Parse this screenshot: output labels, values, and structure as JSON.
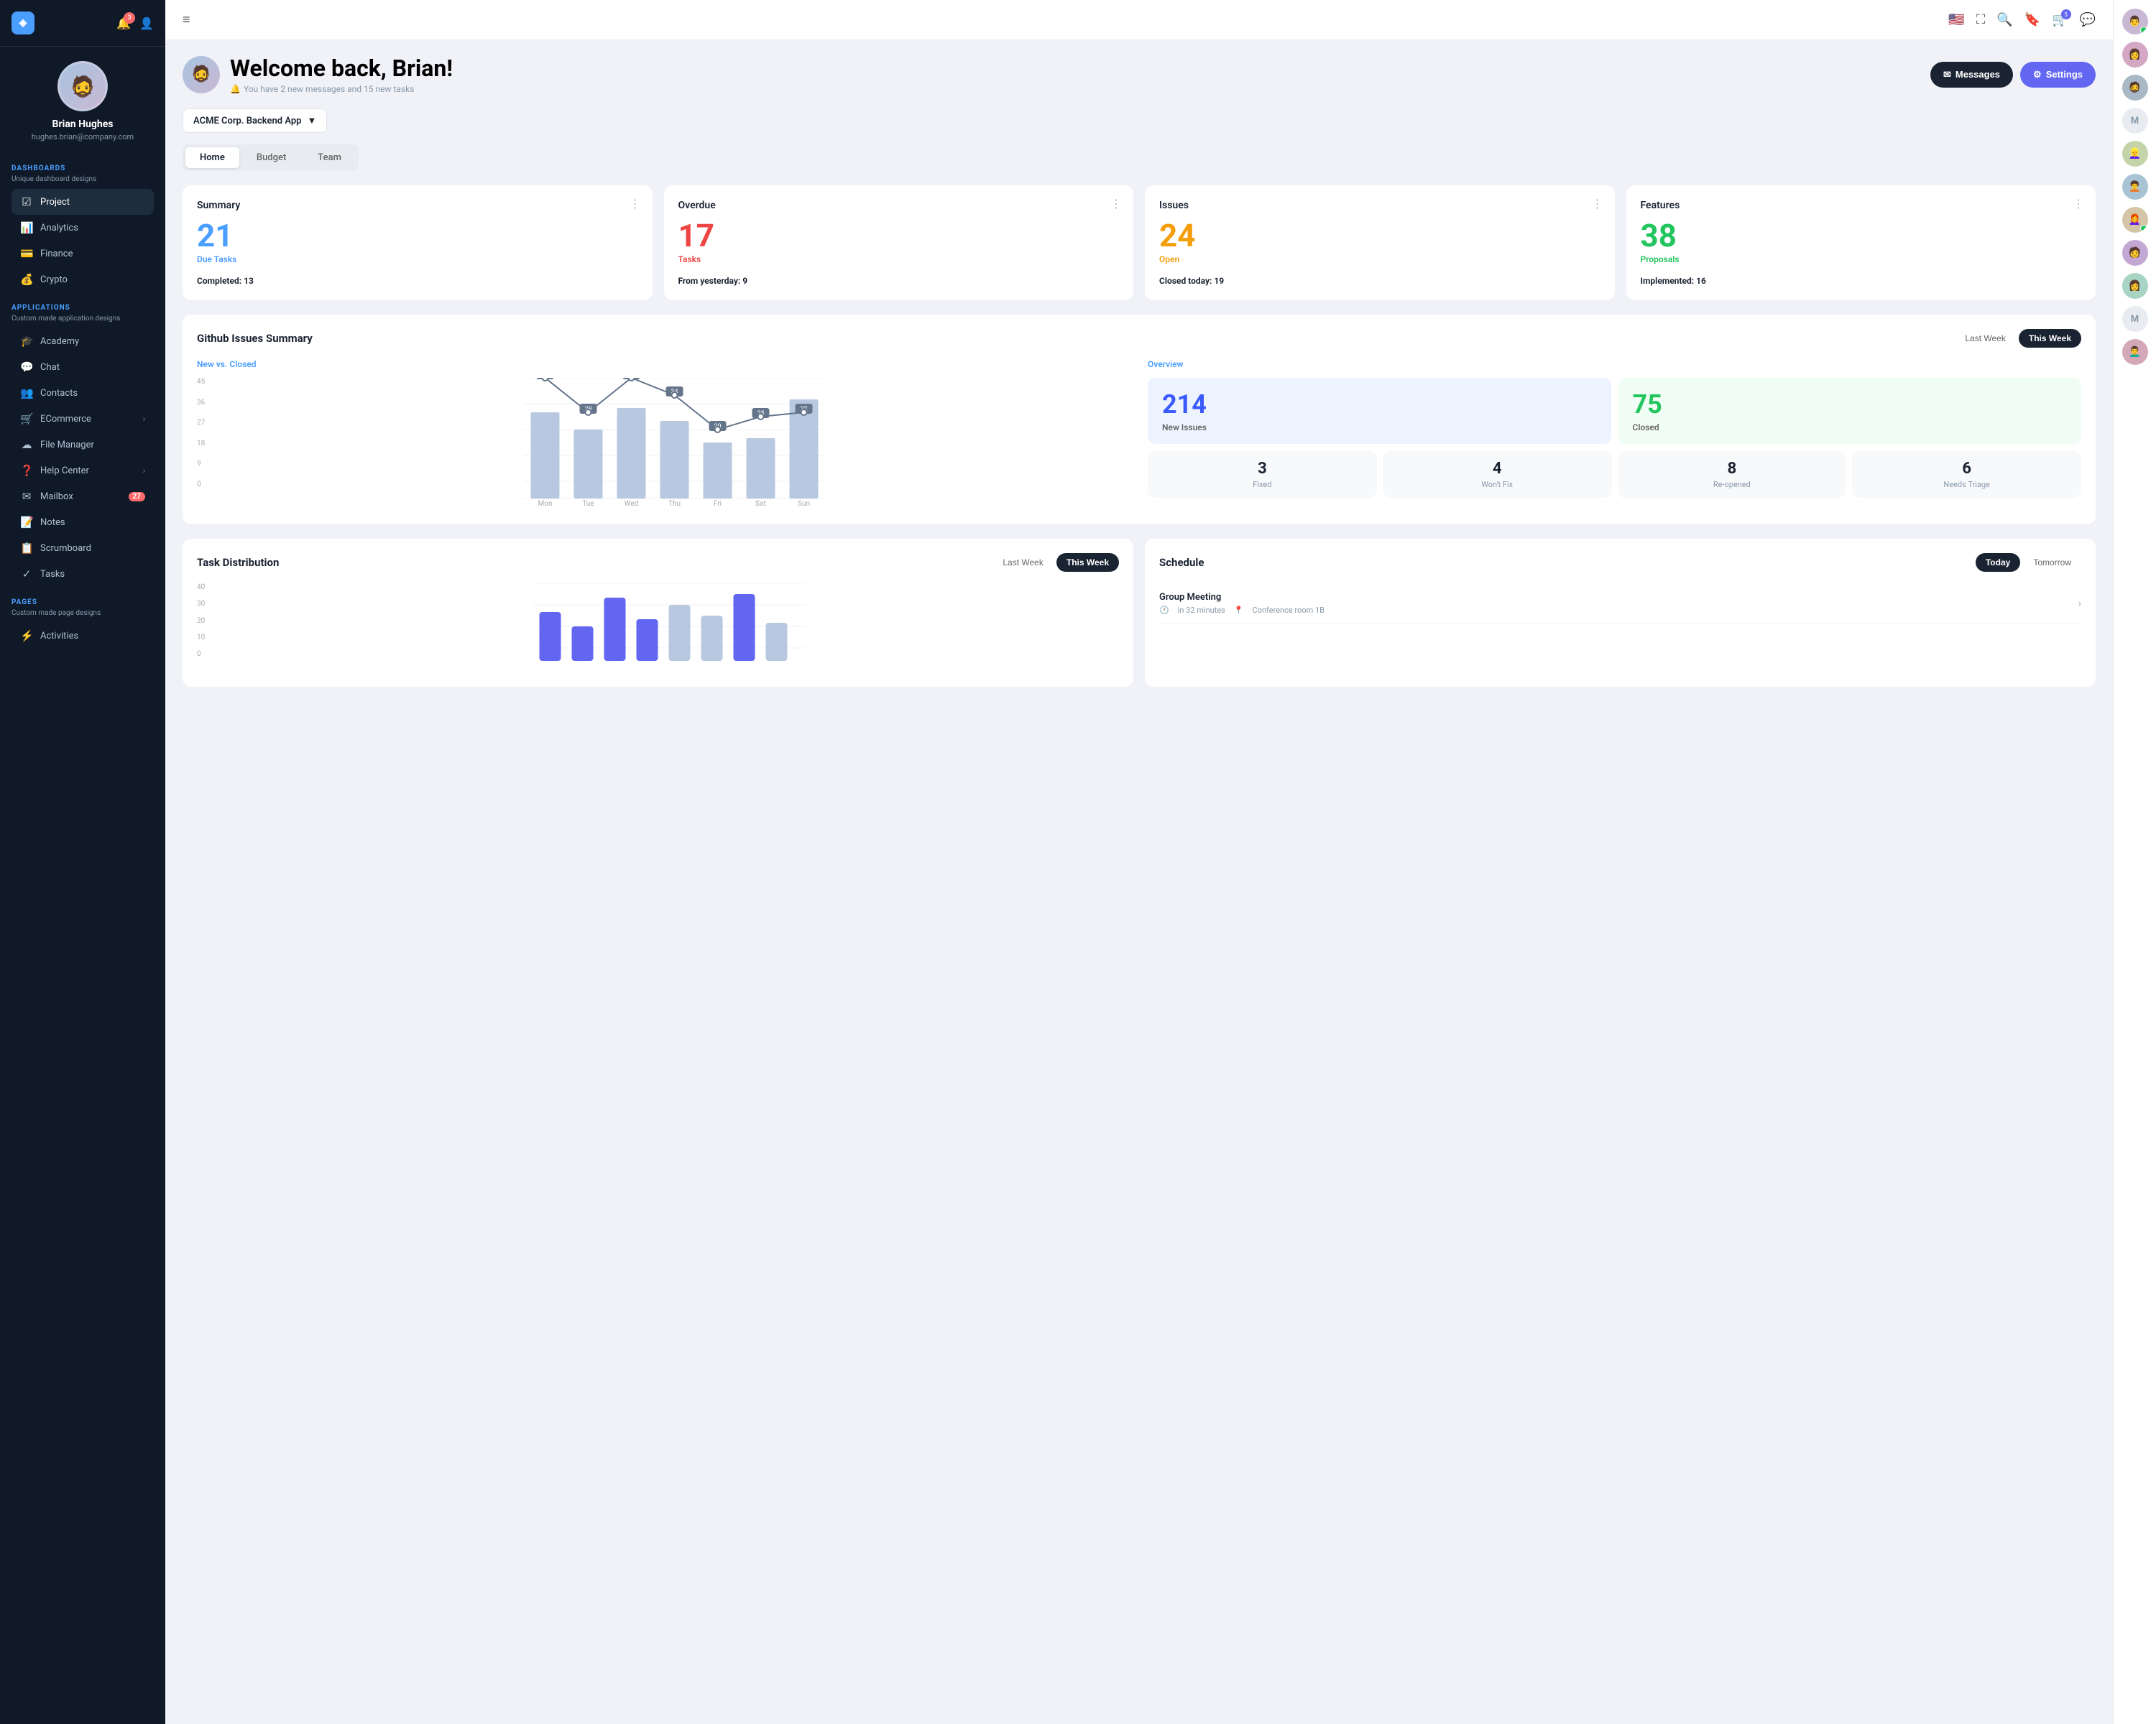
{
  "sidebar": {
    "logo": "◈",
    "notification_count": "3",
    "user": {
      "name": "Brian Hughes",
      "email": "hughes.brian@company.com",
      "avatar": "👤"
    },
    "dashboards_label": "DASHBOARDS",
    "dashboards_desc": "Unique dashboard designs",
    "nav_dashboards": [
      {
        "id": "project",
        "label": "Project",
        "icon": "☑",
        "active": true
      },
      {
        "id": "analytics",
        "label": "Analytics",
        "icon": "📊",
        "active": false
      },
      {
        "id": "finance",
        "label": "Finance",
        "icon": "💳",
        "active": false
      },
      {
        "id": "crypto",
        "label": "Crypto",
        "icon": "💰",
        "active": false
      }
    ],
    "applications_label": "APPLICATIONS",
    "applications_desc": "Custom made application designs",
    "nav_apps": [
      {
        "id": "academy",
        "label": "Academy",
        "icon": "🎓",
        "active": false
      },
      {
        "id": "chat",
        "label": "Chat",
        "icon": "💬",
        "active": false
      },
      {
        "id": "contacts",
        "label": "Contacts",
        "icon": "👥",
        "active": false
      },
      {
        "id": "ecommerce",
        "label": "ECommerce",
        "icon": "🛒",
        "active": false,
        "arrow": true
      },
      {
        "id": "file-manager",
        "label": "File Manager",
        "icon": "☁",
        "active": false
      },
      {
        "id": "help-center",
        "label": "Help Center",
        "icon": "❓",
        "active": false,
        "arrow": true
      },
      {
        "id": "mailbox",
        "label": "Mailbox",
        "icon": "✉",
        "active": false,
        "badge": "27"
      },
      {
        "id": "notes",
        "label": "Notes",
        "icon": "📝",
        "active": false
      },
      {
        "id": "scrumboard",
        "label": "Scrumboard",
        "icon": "📋",
        "active": false
      },
      {
        "id": "tasks",
        "label": "Tasks",
        "icon": "✓",
        "active": false
      }
    ],
    "pages_label": "PAGES",
    "pages_desc": "Custom made page designs",
    "nav_pages": [
      {
        "id": "activities",
        "label": "Activities",
        "icon": "⚡",
        "active": false
      }
    ]
  },
  "topbar": {
    "menu_icon": "≡",
    "flag": "🇺🇸",
    "search_icon": "🔍",
    "bookmark_icon": "🔖",
    "cart_icon": "🛒",
    "cart_badge": "5",
    "messages_icon": "💬"
  },
  "right_panel": {
    "users": [
      {
        "id": "u1",
        "initial": "",
        "emoji": "👨",
        "online": true
      },
      {
        "id": "u2",
        "initial": "",
        "emoji": "👩",
        "online": false
      },
      {
        "id": "u3",
        "initial": "",
        "emoji": "🧔",
        "online": true
      },
      {
        "id": "u4",
        "initial": "M",
        "online": false,
        "placeholder": true
      },
      {
        "id": "u5",
        "initial": "",
        "emoji": "👱‍♀️",
        "online": false
      },
      {
        "id": "u6",
        "initial": "",
        "emoji": "🧑‍🦱",
        "online": false
      },
      {
        "id": "u7",
        "initial": "",
        "emoji": "👩‍🦰",
        "online": true
      },
      {
        "id": "u8",
        "initial": "",
        "emoji": "🧑‍🦫",
        "online": false
      },
      {
        "id": "u9",
        "initial": "",
        "emoji": "👩",
        "online": false
      },
      {
        "id": "u10",
        "initial": "M",
        "online": false,
        "placeholder": true
      },
      {
        "id": "u11",
        "initial": "",
        "emoji": "👨‍🦱",
        "online": false
      }
    ]
  },
  "welcome": {
    "greeting": "Welcome back, Brian!",
    "subtext": "You have 2 new messages and 15 new tasks",
    "bell_icon": "🔔",
    "messages_btn": "Messages",
    "settings_btn": "Settings",
    "messages_icon": "✉",
    "settings_icon": "⚙"
  },
  "project_selector": {
    "label": "ACME Corp. Backend App",
    "arrow": "▼"
  },
  "tabs": [
    {
      "id": "home",
      "label": "Home",
      "active": true
    },
    {
      "id": "budget",
      "label": "Budget",
      "active": false
    },
    {
      "id": "team",
      "label": "Team",
      "active": false
    }
  ],
  "stats": [
    {
      "id": "summary",
      "title": "Summary",
      "number": "21",
      "number_color": "blue",
      "sublabel": "Due Tasks",
      "sublabel_color": "blue",
      "sub_key": "Completed:",
      "sub_val": "13"
    },
    {
      "id": "overdue",
      "title": "Overdue",
      "number": "17",
      "number_color": "red",
      "sublabel": "Tasks",
      "sublabel_color": "red",
      "sub_key": "From yesterday:",
      "sub_val": "9"
    },
    {
      "id": "issues",
      "title": "Issues",
      "number": "24",
      "number_color": "orange",
      "sublabel": "Open",
      "sublabel_color": "orange",
      "sub_key": "Closed today:",
      "sub_val": "19"
    },
    {
      "id": "features",
      "title": "Features",
      "number": "38",
      "number_color": "green",
      "sublabel": "Proposals",
      "sublabel_color": "green",
      "sub_key": "Implemented:",
      "sub_val": "16"
    }
  ],
  "github": {
    "title": "Github Issues Summary",
    "last_week_btn": "Last Week",
    "this_week_btn": "This Week",
    "chart_label": "New vs. Closed",
    "overview_label": "Overview",
    "chart_days": [
      "Mon",
      "Tue",
      "Wed",
      "Thu",
      "Fri",
      "Sat",
      "Sun"
    ],
    "chart_line_values": [
      42,
      28,
      43,
      34,
      20,
      25,
      22
    ],
    "chart_bar_values": [
      30,
      22,
      32,
      26,
      18,
      20,
      38
    ],
    "chart_y_labels": [
      "45",
      "36",
      "27",
      "18",
      "9",
      "0"
    ],
    "new_issues": "214",
    "new_issues_label": "New Issues",
    "closed": "75",
    "closed_label": "Closed",
    "small_stats": [
      {
        "num": "3",
        "label": "Fixed"
      },
      {
        "num": "4",
        "label": "Won't Fix"
      },
      {
        "num": "8",
        "label": "Re-opened"
      },
      {
        "num": "6",
        "label": "Needs Triage"
      }
    ]
  },
  "task_distribution": {
    "title": "Task Distribution",
    "last_week_btn": "Last Week",
    "this_week_btn": "This Week",
    "this_week_active": true,
    "y_labels": [
      "40",
      "30",
      "20",
      "10",
      "0"
    ]
  },
  "schedule": {
    "title": "Schedule",
    "today_btn": "Today",
    "tomorrow_btn": "Tomorrow",
    "items": [
      {
        "name": "Group Meeting",
        "time": "in 32 minutes",
        "location": "Conference room 1B",
        "time_icon": "🕐",
        "location_icon": "📍"
      }
    ]
  }
}
